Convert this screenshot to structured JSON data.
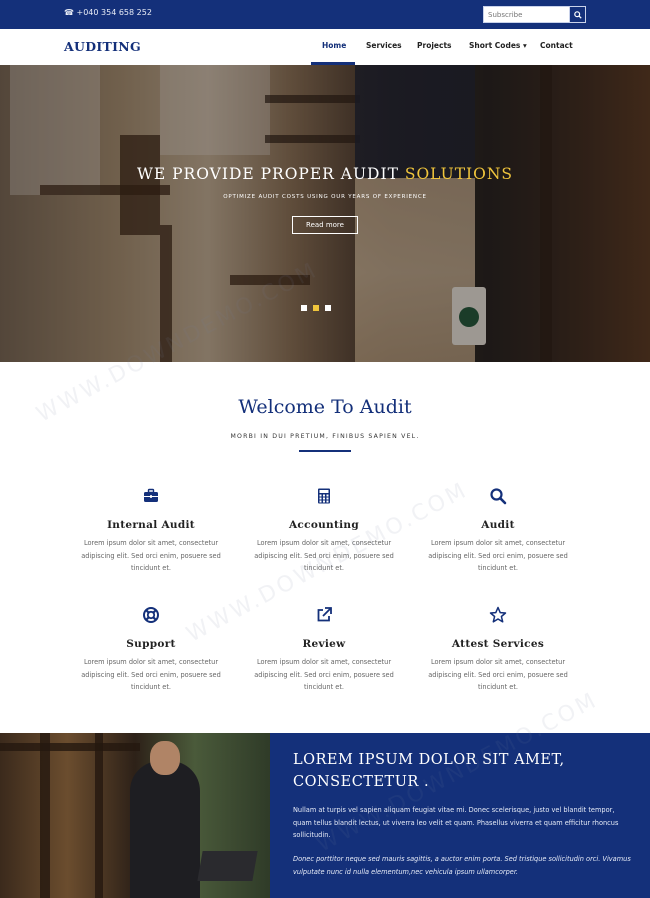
{
  "topbar": {
    "phone": "☎ +040 354 658 252",
    "subscribe_placeholder": "Subscribe",
    "search_icon": "search-icon"
  },
  "nav": {
    "logo": "AUDITING",
    "items": [
      {
        "label": "Home",
        "active": true
      },
      {
        "label": "Services"
      },
      {
        "label": "Projects"
      },
      {
        "label": "Short Codes ▾"
      },
      {
        "label": "Contact"
      }
    ]
  },
  "hero": {
    "title_main": "WE PROVIDE PROPER AUDIT ",
    "title_highlight": "SOLUTIONS",
    "subtitle": "OPTIMIZE AUDIT COSTS USING OUR YEARS OF EXPERIENCE",
    "button": "Read more",
    "slide_count": 3,
    "active_slide": 2
  },
  "welcome": {
    "title": "Welcome To Audit",
    "subtitle": "MORBI IN DUI PRETIUM, FINIBUS SAPIEN VEL."
  },
  "services": [
    {
      "icon": "briefcase-icon",
      "title": "Internal Audit",
      "text": "Lorem ipsum dolor sit amet, consectetur adipiscing elit. Sed orci enim, posuere sed tincidunt et."
    },
    {
      "icon": "calculator-icon",
      "title": "Accounting",
      "text": "Lorem ipsum dolor sit amet, consectetur adipiscing elit. Sed orci enim, posuere sed tincidunt et."
    },
    {
      "icon": "search-icon",
      "title": "Audit",
      "text": "Lorem ipsum dolor sit amet, consectetur adipiscing elit. Sed orci enim, posuere sed tincidunt et."
    },
    {
      "icon": "life-ring-icon",
      "title": "Support",
      "text": "Lorem ipsum dolor sit amet, consectetur adipiscing elit. Sed orci enim, posuere sed tincidunt et."
    },
    {
      "icon": "external-link-icon",
      "title": "Review",
      "text": "Lorem ipsum dolor sit amet, consectetur adipiscing elit. Sed orci enim, posuere sed tincidunt et."
    },
    {
      "icon": "star-icon",
      "title": "Attest Services",
      "text": "Lorem ipsum dolor sit amet, consectetur adipiscing elit. Sed orci enim, posuere sed tincidunt et."
    }
  ],
  "about": {
    "title": "LOREM IPSUM DOLOR SIT AMET, CONSECTETUR .",
    "para1": "Nullam at turpis vel sapien aliquam feugiat vitae mi. Donec scelerisque, justo vel blandit tempor, quam tellus blandit lectus, ut viverra leo velit et quam. Phasellus viverra et quam efficitur rhoncus sollicitudin.",
    "para2": "Donec porttitor neque sed mauris sagittis, a auctor enim porta. Sed tristique sollicitudin orci. Vivamus vulputate nunc id nulla elementum,nec vehicula ipsum ullamcorper."
  },
  "watermark": "WWW.DOWNDEMO.COM",
  "colors": {
    "primary": "#14307a",
    "accent": "#f0c53c"
  }
}
